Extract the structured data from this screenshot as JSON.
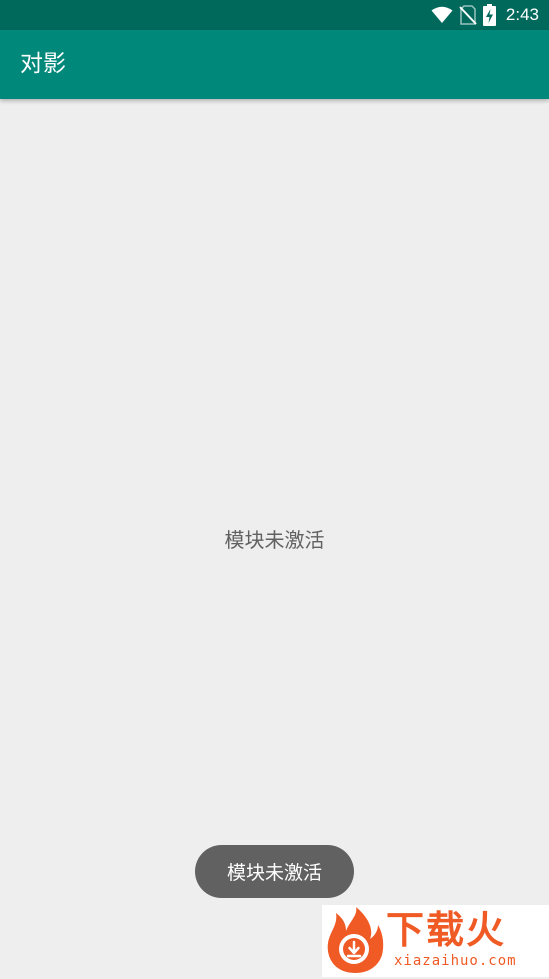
{
  "status_bar": {
    "time": "2:43",
    "icons": [
      "wifi-icon",
      "no-sim-icon",
      "battery-charging-icon"
    ]
  },
  "app_bar": {
    "title": "对影",
    "color": "#00897b",
    "status_color": "#00695c"
  },
  "main": {
    "message": "模块未激活"
  },
  "toast": {
    "text": "模块未激活"
  },
  "watermark": {
    "brand": "下载火",
    "site": "xiazaihuo.com",
    "color": "#f05a24"
  }
}
